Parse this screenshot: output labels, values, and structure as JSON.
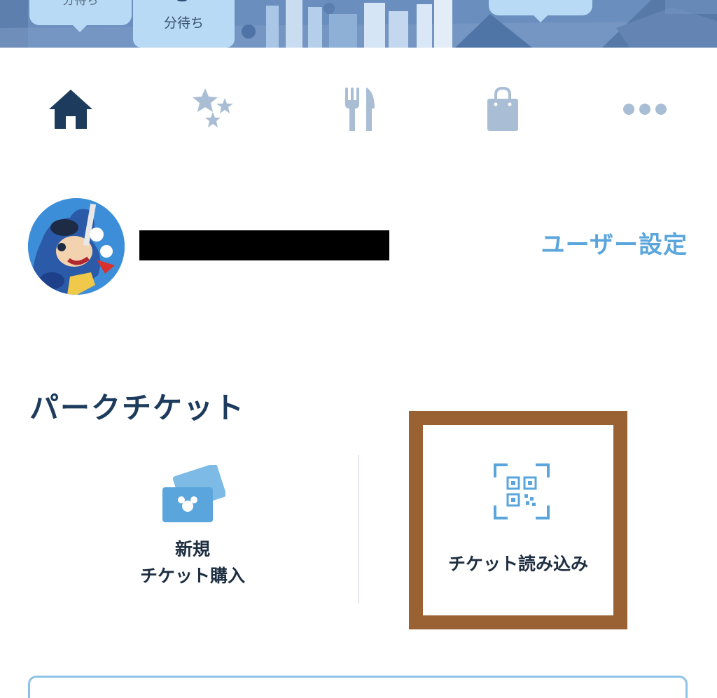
{
  "map_banner": {
    "wait_bubbles": [
      {
        "label": "分待ち"
      },
      {
        "label": "分待ち"
      }
    ]
  },
  "nav": {
    "items": [
      {
        "icon": "home-icon",
        "active": true
      },
      {
        "icon": "stars-icon",
        "active": false
      },
      {
        "icon": "fork-knife-icon",
        "active": false
      },
      {
        "icon": "shopping-bag-icon",
        "active": false
      },
      {
        "icon": "more-icon",
        "active": false
      }
    ],
    "active_color": "#1d3b5c",
    "inactive_color": "#a9bdd4"
  },
  "user": {
    "avatar_icon": "mickey-avatar",
    "settings_label": "ユーザー設定"
  },
  "park_ticket": {
    "title": "パークチケット",
    "buy": {
      "line1": "新規",
      "line2": "チケット購入",
      "icon": "ticket-cards-icon"
    },
    "scan": {
      "label": "チケット読み込み",
      "icon": "qr-scan-icon"
    }
  },
  "colors": {
    "accent": "#5aa6dc",
    "title": "#1d3b5c",
    "highlight_frame": "#9a6233"
  }
}
